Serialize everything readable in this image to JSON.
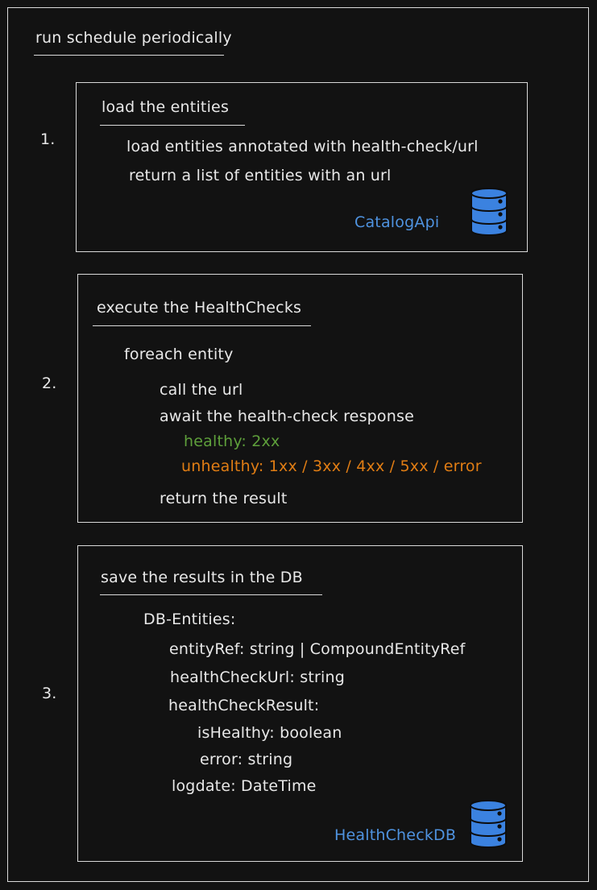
{
  "title": "run schedule periodically",
  "steps": [
    {
      "number": "1.",
      "heading": "load the entities",
      "lines": [
        "load entities annotated with health-check/url",
        "return a list of entities with an url"
      ],
      "db_label": "CatalogApi"
    },
    {
      "number": "2.",
      "heading": "execute the HealthChecks",
      "foreach": "foreach entity",
      "call": "call the url",
      "await": "await the health-check response",
      "healthy": "healthy: 2xx",
      "unhealthy": "unhealthy: 1xx / 3xx / 4xx / 5xx / error",
      "return": "return the result"
    },
    {
      "number": "3.",
      "heading": "save the results in the DB",
      "entities_label": "DB-Entities:",
      "entity_ref": "entityRef: string | CompoundEntityRef",
      "health_check_url": "healthCheckUrl: string",
      "health_check_result": "healthCheckResult:",
      "is_healthy": "isHealthy: boolean",
      "error": "error: string",
      "logdate": "logdate: DateTime",
      "db_label": "HealthCheckDB"
    }
  ],
  "colors": {
    "healthy": "#5e9f3b",
    "unhealthy": "#e07d14",
    "db_label": "#4f93e0",
    "db_icon": "#3b82e0"
  }
}
